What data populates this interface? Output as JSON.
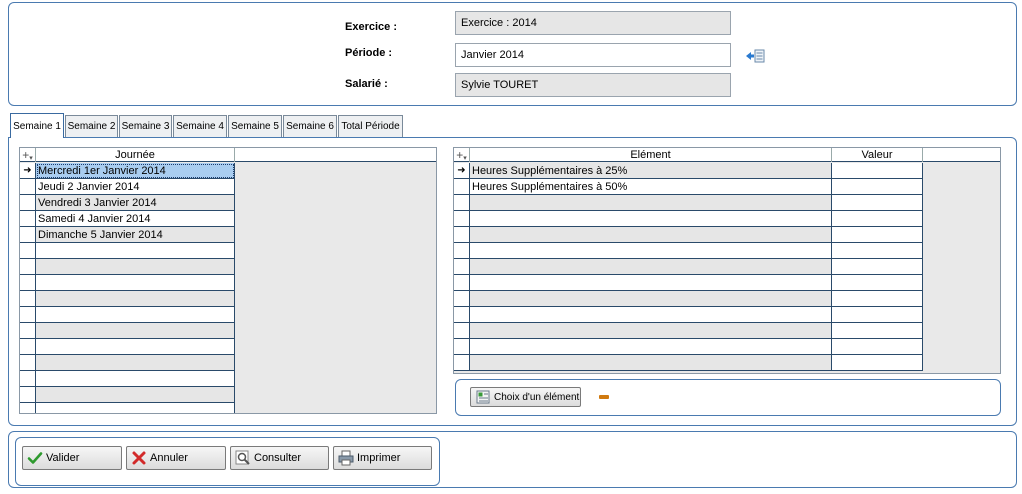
{
  "header": {
    "exercice_label": "Exercice :",
    "exercice_value": "Exercice : 2014",
    "periode_label": "Période :",
    "periode_value": "Janvier 2014",
    "salarie_label": "Salarié :",
    "salarie_value": "Sylvie TOURET"
  },
  "tabs": [
    {
      "label": "Semaine 1",
      "active": true
    },
    {
      "label": "Semaine 2",
      "active": false
    },
    {
      "label": "Semaine 3",
      "active": false
    },
    {
      "label": "Semaine 4",
      "active": false
    },
    {
      "label": "Semaine 5",
      "active": false
    },
    {
      "label": "Semaine 6",
      "active": false
    },
    {
      "label": "Total Période",
      "active": false
    }
  ],
  "days_grid": {
    "corner": "+",
    "column_header": "Journée",
    "rows": [
      "Mercredi 1er Janvier 2014",
      "Jeudi 2 Janvier 2014",
      "Vendredi 3 Janvier 2014",
      "Samedi 4 Janvier 2014",
      "Dimanche 5 Janvier 2014",
      "",
      "",
      "",
      "",
      "",
      "",
      "",
      "",
      "",
      "",
      ""
    ],
    "selected_row": 0
  },
  "elements_grid": {
    "corner": "+",
    "column_element": "Elément",
    "column_valeur": "Valeur",
    "rows": [
      {
        "element": "Heures Supplémentaires à 25%",
        "valeur": ""
      },
      {
        "element": "Heures Supplémentaires à 50%",
        "valeur": ""
      },
      {
        "element": "",
        "valeur": ""
      },
      {
        "element": "",
        "valeur": ""
      },
      {
        "element": "",
        "valeur": ""
      },
      {
        "element": "",
        "valeur": ""
      },
      {
        "element": "",
        "valeur": ""
      },
      {
        "element": "",
        "valeur": ""
      },
      {
        "element": "",
        "valeur": ""
      },
      {
        "element": "",
        "valeur": ""
      },
      {
        "element": "",
        "valeur": ""
      },
      {
        "element": "",
        "valeur": ""
      },
      {
        "element": "",
        "valeur": ""
      }
    ],
    "selected_row": 0
  },
  "choix_button": "Choix d'un élément",
  "actions": {
    "valider": "Valider",
    "annuler": "Annuler",
    "consulter": "Consulter",
    "imprimer": "Imprimer"
  },
  "colors": {
    "panel_border": "#4a7ab0",
    "selected_cell": "#a9cdf0",
    "row_alt": "#e6e6e6"
  }
}
